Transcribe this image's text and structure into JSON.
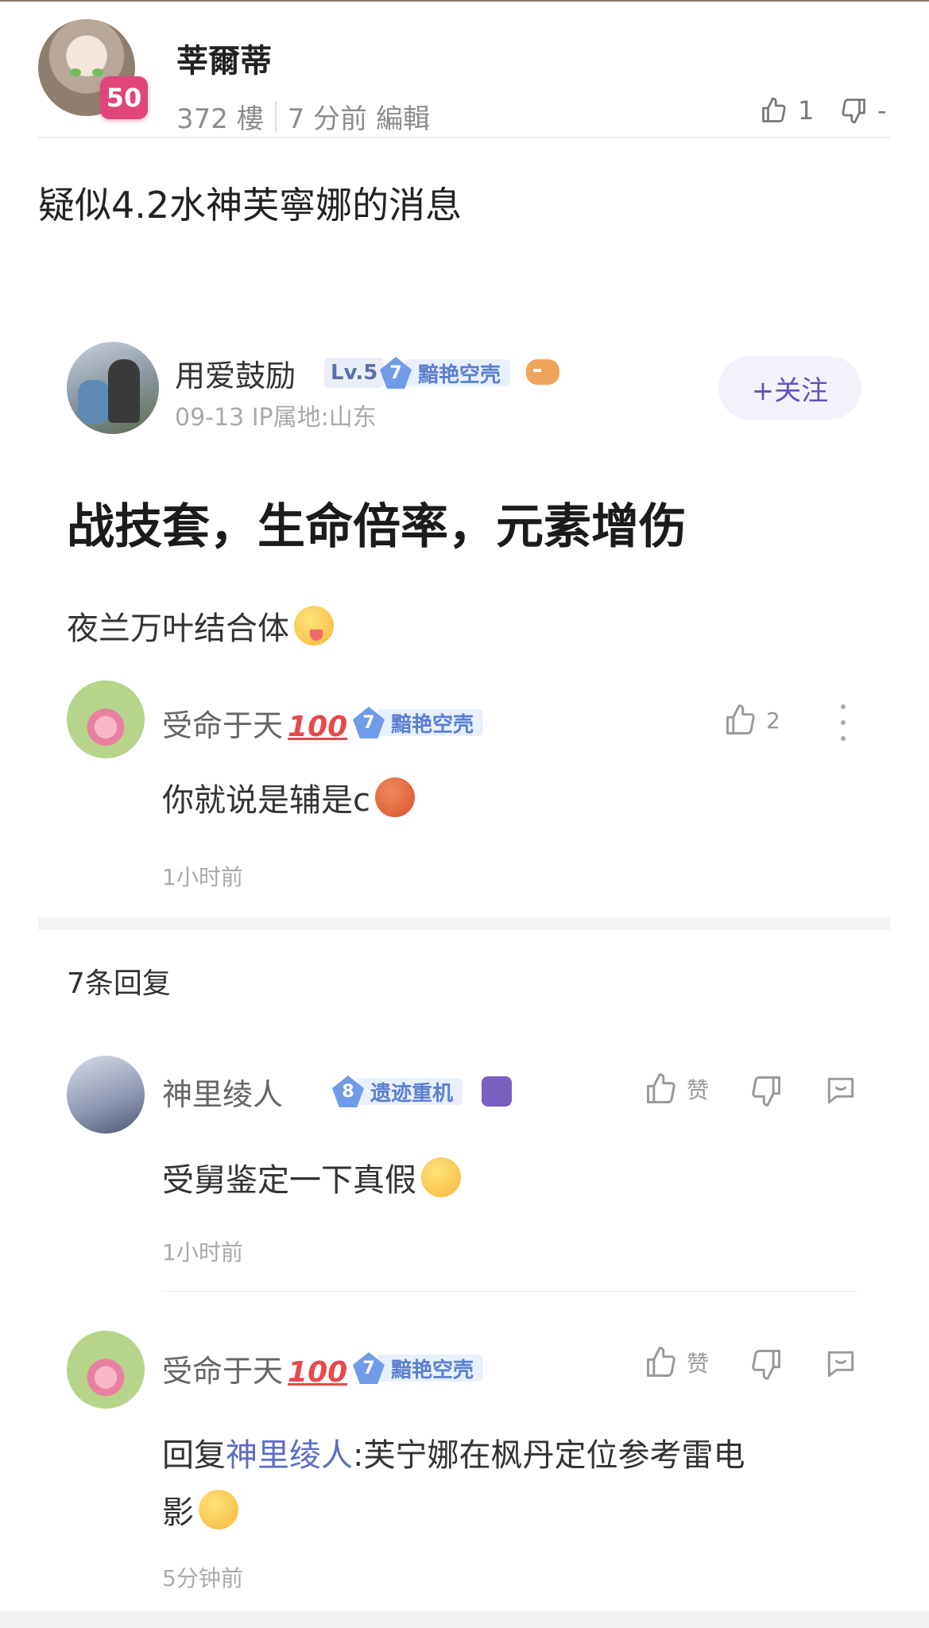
{
  "post": {
    "author": "莘爾蒂",
    "level": "50",
    "floor": "372 樓",
    "time_edit": "7 分前 編輯",
    "likes": "1",
    "dislikes": "-",
    "title": "疑似4.2水神芙寧娜的消息"
  },
  "embed": {
    "author": {
      "name": "用爱鼓励",
      "level": "Lv.5",
      "rank_num": "7",
      "rank_title": "黯艳空壳",
      "meta": "09-13 IP属地:山东",
      "follow_label": "+关注"
    },
    "title": "战技套，生命倍率，元素增伤",
    "body": "夜兰万叶结合体",
    "top_comment": {
      "name": "受命于天",
      "badge": "💯",
      "rank_num": "7",
      "rank_title": "黯艳空壳",
      "likes": "2",
      "text": "你就说是辅是c",
      "time": "1小时前"
    },
    "reply_count": "7条回复",
    "replies": [
      {
        "name": "神里绫人",
        "rank_num": "8",
        "rank_title": "遗迹重机",
        "like_label": "赞",
        "text": "受舅鉴定一下真假",
        "time": "1小时前"
      },
      {
        "name": "受命于天",
        "badge": "💯",
        "rank_num": "7",
        "rank_title": "黯艳空壳",
        "like_label": "赞",
        "text_prefix": "回复 ",
        "text_link": "神里绫人",
        "text_line1": "  :芙宁娜在枫丹定位参考雷电",
        "text_line2": "影",
        "time": "5分钟前"
      }
    ]
  },
  "colors": {
    "level_badge": "#e0457b",
    "link": "#5e6cc4",
    "rank_gem": "#6f9be8"
  },
  "icons": [
    "thumbs-up-icon",
    "thumbs-down-icon",
    "more-vertical-icon",
    "reply-bubble-icon"
  ]
}
